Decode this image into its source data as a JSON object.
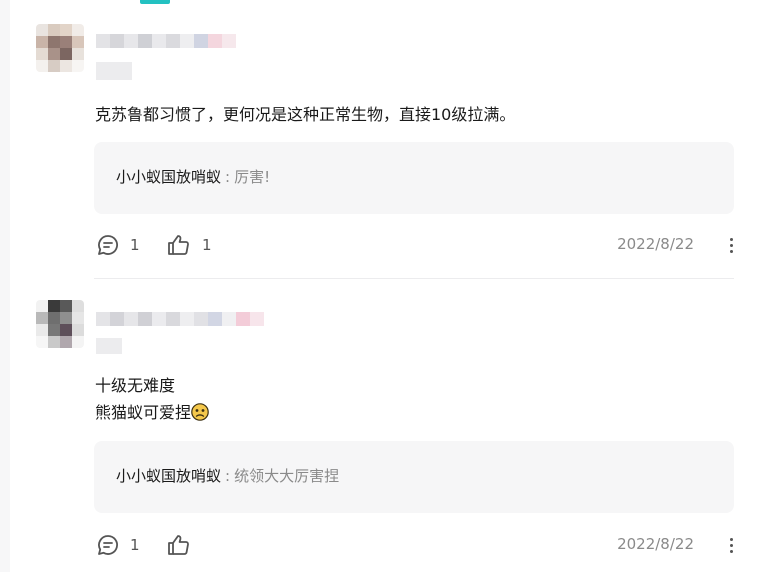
{
  "comments": [
    {
      "text_lines": [
        "克苏鲁都习惯了，更何况是这种正常生物，直接10级拉满。"
      ],
      "reply": {
        "author": "小小蚁国放哨蚁",
        "separator": ":",
        "content": "厉害!"
      },
      "reply_count": "1",
      "like_count": "1",
      "date": "2022/8/22"
    },
    {
      "text_lines": [
        "十级无难度",
        "熊猫蚁可爱捏"
      ],
      "emoji": "worried-face-emoji",
      "reply": {
        "author": "小小蚁国放哨蚁",
        "separator": ":",
        "content": "统领大大厉害捏"
      },
      "reply_count": "1",
      "like_count": "",
      "date": "2022/8/22"
    }
  ],
  "colors": {
    "accent": "#23c1c1",
    "reply_bg": "#f6f6f7",
    "muted_text": "#8a8a8a"
  }
}
